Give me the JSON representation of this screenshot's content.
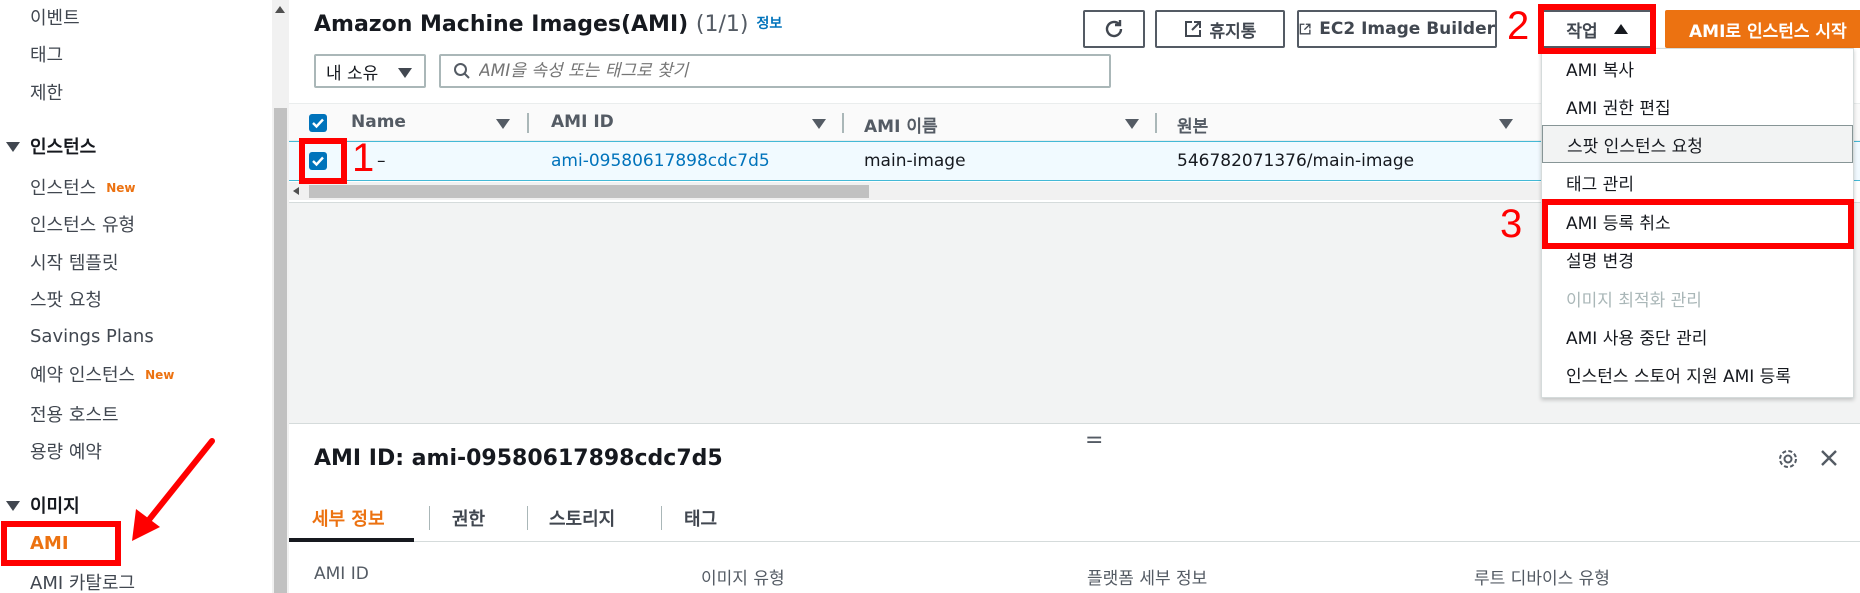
{
  "sidebar": {
    "items_top": [
      "이벤트",
      "태그",
      "제한"
    ],
    "section_instances": "인스턴스",
    "instances": [
      {
        "label": "인스턴스",
        "badge": "New"
      },
      {
        "label": "인스턴스 유형",
        "badge": ""
      },
      {
        "label": "시작 템플릿",
        "badge": ""
      },
      {
        "label": "스팟 요청",
        "badge": ""
      },
      {
        "label": "Savings Plans",
        "badge": ""
      },
      {
        "label": "예약 인스턴스",
        "badge": "New"
      },
      {
        "label": "전용 호스트",
        "badge": ""
      },
      {
        "label": "용량 예약",
        "badge": ""
      }
    ],
    "section_images": "이미지",
    "images": [
      "AMI",
      "AMI 카탈로그"
    ]
  },
  "header": {
    "title": "Amazon Machine Images(AMI)",
    "count": "(1/1)",
    "info": "정보",
    "hibernate_label": "휴지통",
    "builder_label": "EC2 Image Builder",
    "actions_label": "작업",
    "launch_label": "AMI로 인스턴스 시작"
  },
  "filter": {
    "owner_value": "내 소유",
    "search_placeholder": "AMI을 속성 또는 태그로 찾기"
  },
  "table": {
    "columns": [
      "Name",
      "AMI ID",
      "AMI 이름",
      "원본"
    ],
    "rows": [
      {
        "name": "–",
        "ami_id": "ami-09580617898cdc7d5",
        "ami_name": "main-image",
        "source": "546782071376/main-image"
      }
    ]
  },
  "actions_menu": {
    "items": [
      {
        "label": "AMI 복사",
        "disabled": false
      },
      {
        "label": "AMI 권한 편집",
        "disabled": false
      },
      {
        "label": "스팟 인스턴스 요청",
        "disabled": false
      },
      {
        "label": "태그 관리",
        "disabled": false
      },
      {
        "label": "AMI 등록 취소",
        "disabled": false
      },
      {
        "label": "설명 변경",
        "disabled": false
      },
      {
        "label": "이미지 최적화 관리",
        "disabled": true
      },
      {
        "label": "AMI 사용 중단 관리",
        "disabled": false
      },
      {
        "label": "인스턴스 스토어 지원 AMI 등록",
        "disabled": false
      }
    ]
  },
  "split_panel": {
    "title": "AMI ID: ami-09580617898cdc7d5",
    "tabs": [
      "세부 정보",
      "권한",
      "스토리지",
      "태그"
    ],
    "detail_labels": [
      "AMI ID",
      "이미지 유형",
      "플랫폼 세부 정보",
      "루트 디바이스 유형"
    ]
  },
  "annotations": [
    "1",
    "2",
    "3"
  ],
  "colors": {
    "accent": "#ec7211",
    "link": "#0073bb",
    "annotation": "#ff0000"
  }
}
